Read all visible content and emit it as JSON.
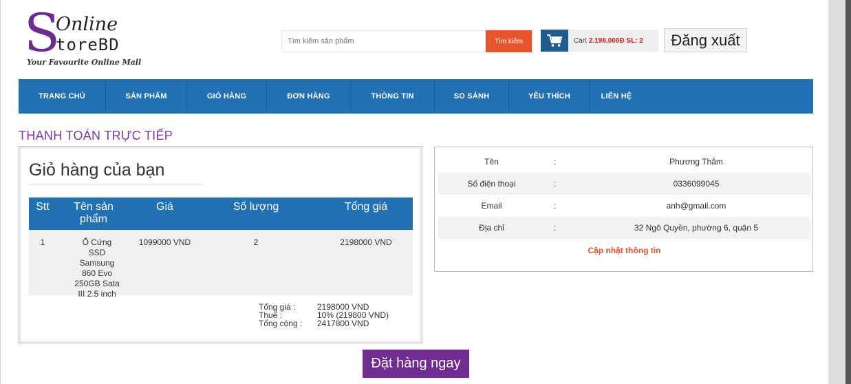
{
  "logo": {
    "letter": "S",
    "line1": "Online",
    "line2": "toreBD",
    "tagline": "Your Favourite Online Mall"
  },
  "search": {
    "placeholder": "Tìm kiếm sản phẩm",
    "button_label": "Tìm kiếm"
  },
  "cart": {
    "icon": "shopping-cart-icon",
    "label": "Cart",
    "value": "2.198.000Đ SL: 2"
  },
  "logout_label": "Đăng xuất",
  "nav": {
    "items": [
      {
        "label": "TRANG CHỦ"
      },
      {
        "label": "SẢN PHẨM"
      },
      {
        "label": "GIỎ HÀNG"
      },
      {
        "label": "ĐƠN HÀNG"
      },
      {
        "label": "THÔNG TIN"
      },
      {
        "label": "SO SÁNH"
      },
      {
        "label": "YÊU THÍCH"
      },
      {
        "label": "LIÊN HỆ"
      }
    ]
  },
  "section_title": "THANH TOÁN TRỰC TIẾP",
  "cart_panel": {
    "heading": "Giỏ hàng của bạn",
    "columns": [
      "Stt",
      "Tên sản phẩm",
      "Giá",
      "Số lượng",
      "Tổng giá"
    ],
    "rows": [
      {
        "stt": "1",
        "name": "Ổ Cứng SSD Samsung 860 Evo 250GB Sata III 2.5 inch",
        "price": "1099000 VND",
        "qty": "2",
        "total": "2198000 VND"
      }
    ],
    "summary": {
      "subtotal_label": "Tổng giá :",
      "subtotal_value": "2198000 VND",
      "tax_label": "Thuế :",
      "tax_value": "10% (219800 VND)",
      "grand_label": "Tổng cộng :",
      "grand_value": "2417800 VND"
    }
  },
  "info_panel": {
    "separator": ":",
    "rows": [
      {
        "label": "Tên",
        "value": "Phương Thắm"
      },
      {
        "label": "Số điện thoại",
        "value": "0336099045"
      },
      {
        "label": "Email",
        "value": "anh@gmail.com"
      },
      {
        "label": "Địa chỉ",
        "value": "32 Ngô Quyền, phường 6, quận 5"
      }
    ],
    "update_link": "Cập nhật thông tin"
  },
  "order_button": "Đặt hàng ngay",
  "colors": {
    "nav_blue": "#2072b5",
    "brand_purple": "#6f2c91",
    "accent_orange": "#e9552b",
    "cart_red": "#d0201a"
  }
}
